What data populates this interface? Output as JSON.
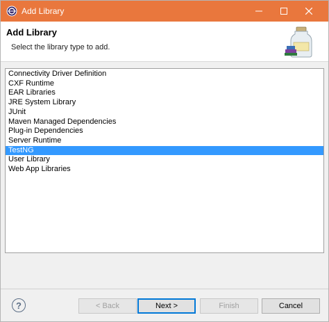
{
  "window": {
    "title": "Add Library",
    "accent": "#e9773d"
  },
  "header": {
    "title": "Add Library",
    "description": "Select the library type to add."
  },
  "list": {
    "items": [
      "Connectivity Driver Definition",
      "CXF Runtime",
      "EAR Libraries",
      "JRE System Library",
      "JUnit",
      "Maven Managed Dependencies",
      "Plug-in Dependencies",
      "Server Runtime",
      "TestNG",
      "User Library",
      "Web App Libraries"
    ],
    "selected": "TestNG",
    "selection_color": "#3399ff"
  },
  "buttons": {
    "help": "?",
    "back": "< Back",
    "next": "Next >",
    "finish": "Finish",
    "cancel": "Cancel"
  },
  "icons": {
    "title_icon": "eclipse-icon",
    "header_image": "library-jar-icon",
    "minimize": "minimize-icon",
    "maximize": "maximize-icon",
    "close": "close-icon",
    "help": "help-icon"
  }
}
